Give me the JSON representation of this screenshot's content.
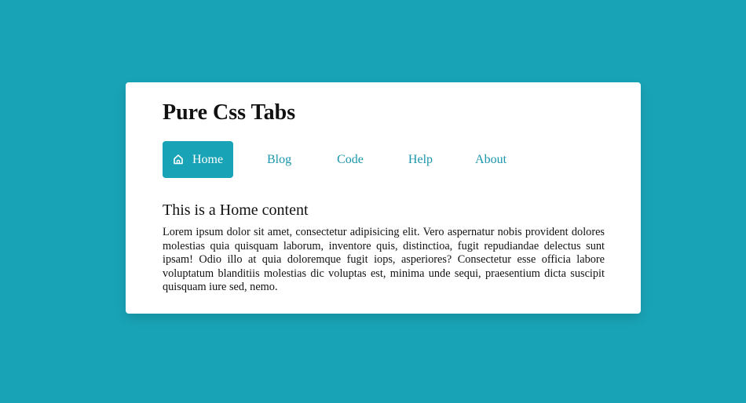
{
  "colors": {
    "background": "#19a3b6",
    "card": "#ffffff",
    "accent": "#19a3b6",
    "tab_text": "#1a96ab"
  },
  "page": {
    "title": "Pure Css Tabs"
  },
  "tabs": [
    {
      "label": "Home",
      "icon": "home-icon",
      "active": true
    },
    {
      "label": "Blog",
      "active": false
    },
    {
      "label": "Code",
      "active": false
    },
    {
      "label": "Help",
      "active": false
    },
    {
      "label": "About",
      "active": false
    }
  ],
  "content": {
    "heading": "This is a Home content",
    "body": "Lorem ipsum dolor sit amet, consectetur adipisicing elit. Vero aspernatur nobis provident dolores molestias quia quisquam laborum, inventore quis, distinctioa, fugit repudiandae delectus sunt ipsam! Odio illo at quia doloremque fugit iops, asperiores? Consectetur esse officia labore voluptatum blanditiis molestias dic voluptas est, minima unde sequi, praesentium dicta suscipit quisquam iure sed, nemo."
  }
}
